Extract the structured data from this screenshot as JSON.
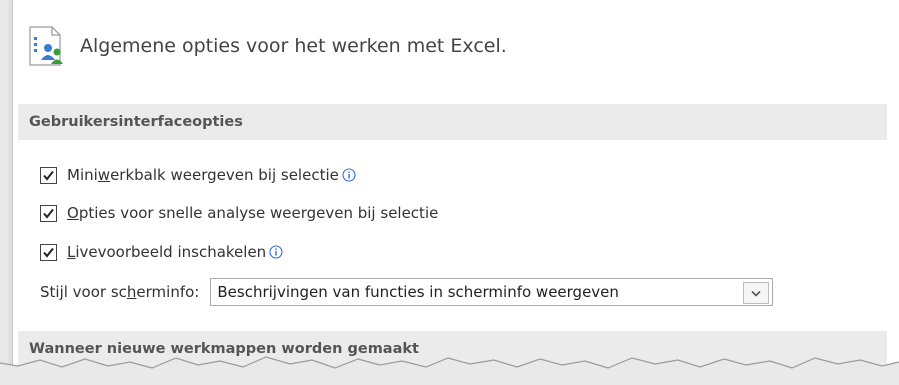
{
  "header": {
    "icon": "general-options-icon",
    "title": "Algemene opties voor het werken met Excel."
  },
  "ui_section": {
    "title": "Gebruikersinterfaceopties",
    "options": [
      {
        "pre": "Mini",
        "accel": "w",
        "post": "erkbalk weergeven bij selectie",
        "checked": true,
        "info": true
      },
      {
        "pre": "",
        "accel": "O",
        "post": "pties voor snelle analyse weergeven bij selectie",
        "checked": true,
        "info": false
      },
      {
        "pre": "",
        "accel": "L",
        "post": "ivevoorbeeld inschakelen",
        "checked": true,
        "info": true
      }
    ],
    "screentip": {
      "label_pre": "Stijl voor sc",
      "label_accel": "h",
      "label_post": "erminfo:",
      "value": "Beschrijvingen van functies in scherminfo weergeven"
    }
  },
  "new_workbooks_section": {
    "title": "Wanneer nieuwe werkmappen worden gemaakt"
  },
  "colors": {
    "section_bg": "#ebebeb",
    "info_blue": "#2f6fd1",
    "torn_edge_bg": "#e9e9e9"
  }
}
